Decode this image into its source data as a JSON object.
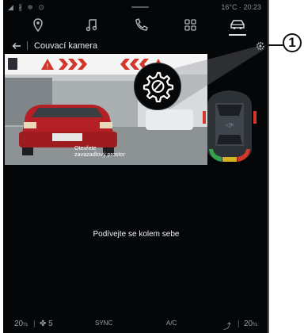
{
  "status_bar": {
    "left_icons": "◢ ∦ ≑ ⊙",
    "temperature": "16°C",
    "time": "20:23"
  },
  "nav": {
    "items": [
      {
        "name": "location",
        "icon": "map-pin-icon"
      },
      {
        "name": "music",
        "icon": "music-note-icon"
      },
      {
        "name": "phone",
        "icon": "phone-icon"
      },
      {
        "name": "apps",
        "icon": "apps-grid-icon"
      },
      {
        "name": "vehicle",
        "icon": "car-icon",
        "active": true
      }
    ]
  },
  "header": {
    "title": "Couvací kamera"
  },
  "camera": {
    "overlay_text": "Otevřete zavazadlový prostor"
  },
  "center_message": "Podívejte se kolem sebe",
  "climate": {
    "left_temp": "20",
    "left_temp_half": "½",
    "fan_speed": "5",
    "sync": "SYNC",
    "ac": "A/C",
    "right_temp": "20",
    "right_temp_half": "½"
  },
  "callout": {
    "number": "1"
  },
  "colors": {
    "accent_red": "#d3372b",
    "nav_active": "#d9e1e8",
    "sensor_green": "#33a24b",
    "sensor_yellow": "#d6b324"
  }
}
